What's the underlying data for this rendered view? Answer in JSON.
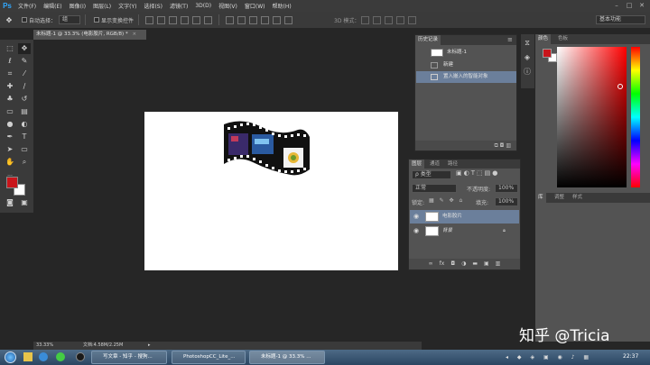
{
  "app": {
    "logo": "Ps"
  },
  "menu": [
    "文件(F)",
    "编辑(E)",
    "图像(I)",
    "图层(L)",
    "文字(Y)",
    "选择(S)",
    "滤镜(T)",
    "3D(D)",
    "视图(V)",
    "窗口(W)",
    "帮助(H)"
  ],
  "window_controls": {
    "minimize": "–",
    "maximize": "□",
    "close": "✕"
  },
  "options": {
    "auto_select_label": "自动选择：",
    "auto_select_value": "组",
    "show_transform_label": "显示变换控件",
    "mode_3d_label": "3D 模式：",
    "workspace": "基本功能"
  },
  "document": {
    "tab_title": "未标题-1 @ 33.3% (电影胶片, RGB/8) *",
    "close": "×"
  },
  "history": {
    "tab_label": "历史记录",
    "snapshot": "未标题-1",
    "items": [
      "新建",
      "置入嵌入的智能对象"
    ]
  },
  "color_panel": {
    "tabs": [
      "颜色",
      "色板"
    ],
    "foreground": "#c8151b",
    "background": "#ffffff"
  },
  "props_panel": {
    "tabs": [
      "库",
      "调整",
      "样式"
    ]
  },
  "layers": {
    "tabs": [
      "图层",
      "通道",
      "路径"
    ],
    "filter_label": "ρ 类型",
    "blend_mode": "正常",
    "opacity_label": "不透明度:",
    "opacity_value": "100%",
    "lock_label": "锁定:",
    "fill_label": "填充:",
    "fill_value": "100%",
    "items": [
      {
        "name": "电影胶片",
        "selected": true
      },
      {
        "name": "背景",
        "selected": false
      }
    ],
    "footer_icons": [
      "link-icon",
      "fx-icon",
      "mask-icon",
      "adjustment-icon",
      "group-icon",
      "new-layer-icon",
      "trash-icon"
    ]
  },
  "status": {
    "zoom": "33.33%",
    "doc_size": "文档:4.58M/2.25M",
    "arrow": "▸"
  },
  "taskbar": {
    "items": [
      "写文章 - 知乎 - 搜狗...",
      "PhotoshopCC_Lite_...",
      "未标题-1 @ 33.3% ..."
    ],
    "clock": "22:37"
  },
  "watermark": "知乎 @Tricia"
}
